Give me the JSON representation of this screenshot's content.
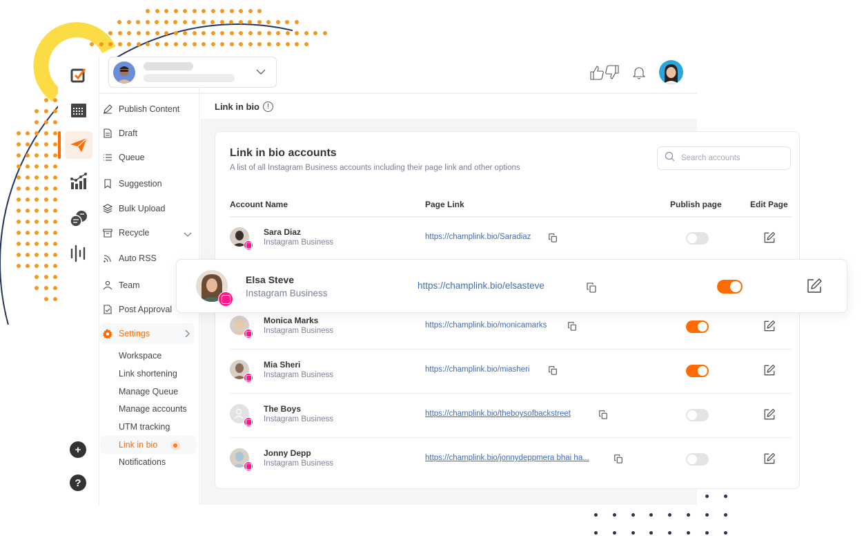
{
  "workspace": {
    "selector_label": "Workspace selector"
  },
  "sidebar": {
    "items": [
      {
        "label": "Publish Content",
        "icon": "pencil-icon"
      },
      {
        "label": "Draft",
        "icon": "document-icon"
      },
      {
        "label": "Queue",
        "icon": "list-icon"
      },
      {
        "label": "Suggestion",
        "icon": "bookmark-icon"
      },
      {
        "label": "Bulk Upload",
        "icon": "layers-icon"
      },
      {
        "label": "Recycle",
        "icon": "archive-icon"
      },
      {
        "label": "Auto RSS",
        "icon": "rss-icon"
      },
      {
        "label": "Team",
        "icon": "user-icon"
      },
      {
        "label": "Post Approval",
        "icon": "file-check-icon"
      }
    ],
    "settings": {
      "label": "Settings",
      "icon": "gear-icon",
      "sub_items": [
        {
          "label": "Workspace"
        },
        {
          "label": "Link shortening"
        },
        {
          "label": "Manage Queue"
        },
        {
          "label": "Manage accounts"
        },
        {
          "label": "UTM tracking"
        },
        {
          "label": "Link in bio",
          "active": true
        },
        {
          "label": "Notifications"
        }
      ]
    }
  },
  "rail": {
    "icons": [
      "task-check-icon",
      "calendar-icon",
      "paper-plane-icon",
      "analytics-icon",
      "chat-icon",
      "audio-wave-icon"
    ],
    "active": "paper-plane-icon",
    "bottom": {
      "add": "+",
      "help": "?"
    }
  },
  "header": {
    "feedback_icon": "thumbs-up-down-icon",
    "notification_icon": "bell-icon"
  },
  "page": {
    "title": "Link in bio",
    "info_glyph": "!"
  },
  "card": {
    "title": "Link in bio accounts",
    "subtitle": "A list of all Instagram Business accounts including their page link and other options",
    "search_placeholder": "Search accounts",
    "columns": [
      "Account Name",
      "Page Link",
      "Publish page",
      "Edit Page"
    ],
    "rows": [
      {
        "name": "Sara Diaz",
        "type": "Instagram Business",
        "link": "https://champlink.bio/Saradiaz",
        "published": false,
        "avatar_color": "#3a2f2a"
      },
      {
        "name": "Elsa Steve",
        "type": "Instagram Business",
        "link": "https://champlink.bio/elsasteve",
        "published": true,
        "avatar_color": "#6b4a36",
        "highlighted": true
      },
      {
        "name": "Monica Marks",
        "type": "Instagram Business",
        "link": "https://champlink.bio/monicamarks",
        "published": true,
        "avatar_color": "#e8c9a8"
      },
      {
        "name": "Mia Sheri",
        "type": "Instagram Business",
        "link": "https://champlink.bio/miasheri",
        "published": true,
        "avatar_color": "#8a6a55"
      },
      {
        "name": "The Boys",
        "type": "Instagram Business",
        "link": "https://champlink.bio/theboysofbackstreet",
        "published": false,
        "avatar_color": "#e2e2e2",
        "placeholder_avatar": true
      },
      {
        "name": "Jonny Depp",
        "type": "Instagram Business",
        "link": "https://champlink.bio/jonnydeppmera bhai ha...",
        "published": false,
        "avatar_color": "#a9c4d6"
      }
    ]
  },
  "colors": {
    "accent": "#ff6b00",
    "link": "#3e6cb8",
    "instagram": "#ff1a8c",
    "toggle_off": "#e4e4e4",
    "deco_orange": "#f7941d",
    "deco_yellow": "#fbdc45",
    "deco_navy": "#26335f"
  }
}
